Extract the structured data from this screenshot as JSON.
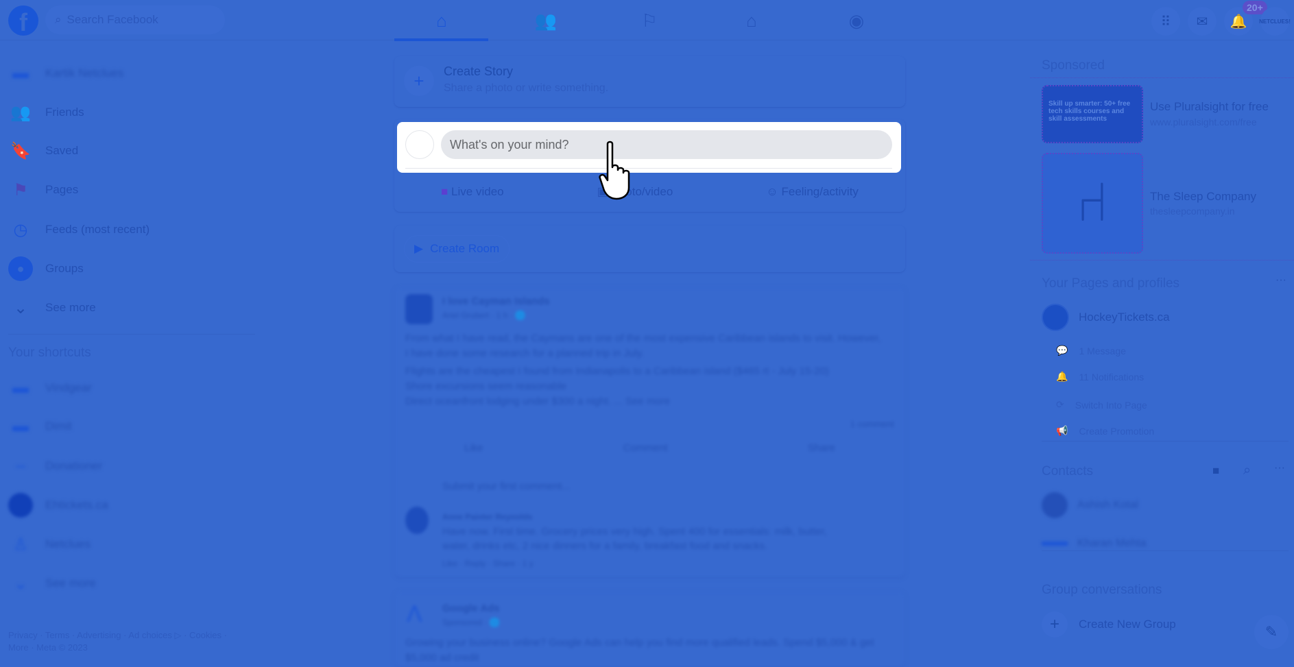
{
  "header": {
    "search_placeholder": "Search Facebook",
    "notification_badge": "20+",
    "profile_label": "NETCLUES!",
    "nav": [
      "home",
      "friends",
      "pages",
      "marketplace",
      "groups"
    ]
  },
  "sidebar": {
    "profile_name": "Kartik Netclues",
    "items": [
      {
        "label": "Friends",
        "icon": "friends-icon"
      },
      {
        "label": "Saved",
        "icon": "bookmark-icon"
      },
      {
        "label": "Pages",
        "icon": "flag-icon"
      },
      {
        "label": "Feeds (most recent)",
        "icon": "feeds-icon"
      },
      {
        "label": "Groups",
        "icon": "groups-icon"
      },
      {
        "label": "See more",
        "icon": "chevron-down-icon"
      }
    ],
    "shortcuts_title": "Your shortcuts",
    "shortcuts": [
      "Vindgear",
      "Dimit",
      "Donationer",
      "Ehtickets.ca",
      "Netclues",
      "See more"
    ],
    "footer_line1": "Privacy · Terms · Advertising · Ad choices ▷ · Cookies ·",
    "footer_line2": "More · Meta © 2023"
  },
  "feed": {
    "create_story": {
      "title": "Create Story",
      "subtitle": "Share a photo or write something."
    },
    "composer": {
      "placeholder": "What's on your mind?",
      "actions": [
        "Live video",
        "Photo/video",
        "Feeling/activity"
      ]
    },
    "create_room": "Create Room",
    "post1": {
      "author": "I love Cayman Islands",
      "meta": "Ariel Grubert · 1 h · 🌐",
      "text": "From what I have read, the Caymans are one of the most expensive Caribbean islands to visit. However, I have done some research for a planned trip in July.",
      "bullets": [
        "Flights are the cheapest I found from Indianapolis to a Caribbean island ($465 rt - July 15-20)",
        "Shore excursions seem reasonable",
        "Direct oceanfront lodging under $300 a night. ... See more"
      ],
      "comments_count": "1 comment",
      "like": "Like",
      "comment": "Comment",
      "share": "Share",
      "comment_placeholder": "Submit your first comment...",
      "reply_author": "Anne Painter Reynolds",
      "reply_text": "Have now. First time. Grocery prices very high. Spent 400 for essentials: milk, butter, water, drinks etc, 2 nice dinners for a family, breakfast food and snacks.",
      "reply_actions": "Like · Reply · Share · 1 y"
    },
    "post2": {
      "author": "Google Ads",
      "meta": "Sponsored · 🌐",
      "text": "Growing your business online? Google Ads can help you find more qualified leads. Spend $5,000 & get $5,000 ad credit"
    }
  },
  "right": {
    "sponsored_title": "Sponsored",
    "ads": [
      {
        "title": "Use Pluralsight for free",
        "url": "www.pluralsight.com/free",
        "image_text": "Skill up smarter: 50+ free tech skills courses and skill assessments"
      },
      {
        "title": "The Sleep Company",
        "url": "thesleepcompany.in"
      }
    ],
    "pages_title": "Your Pages and profiles",
    "page_name": "HockeyTickets.ca",
    "page_items": [
      "1 Message",
      "11 Notifications",
      "Switch Into Page",
      "Create Promotion"
    ],
    "contacts_title": "Contacts",
    "contacts": [
      "Ashish Kotal",
      "Kharan Mehta"
    ],
    "group_title": "Group conversations",
    "create_group": "Create New Group"
  }
}
